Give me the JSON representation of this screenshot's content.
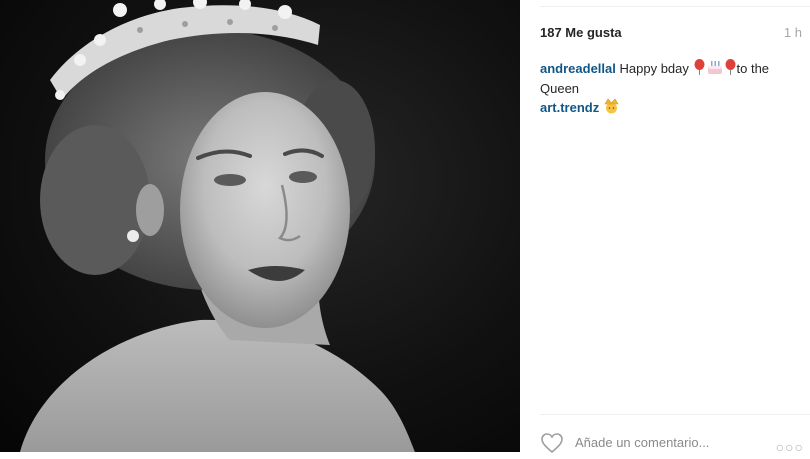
{
  "post": {
    "likes_text": "187 Me gusta",
    "time_text": "1 h"
  },
  "comments": [
    {
      "username": "andreadellal",
      "text_before": "Happy bday ",
      "emojis": [
        "balloon-emoji",
        "birthday-cake-emoji",
        "balloon-emoji"
      ],
      "text_after": "to the Queen"
    },
    {
      "username": "art.trendz",
      "emojis": [
        "crown-face-emoji"
      ]
    }
  ],
  "footer": {
    "comment_placeholder": "Añade un comentario...",
    "more_label": "○○○"
  },
  "icons": {
    "like": "heart-icon",
    "more": "more-options-icon"
  },
  "colors": {
    "username": "#125688",
    "text": "#262626",
    "meta": "#a5a7aa",
    "balloon": "#e0403a",
    "cake": "#f3c6d2",
    "crown": "#f2b530"
  }
}
